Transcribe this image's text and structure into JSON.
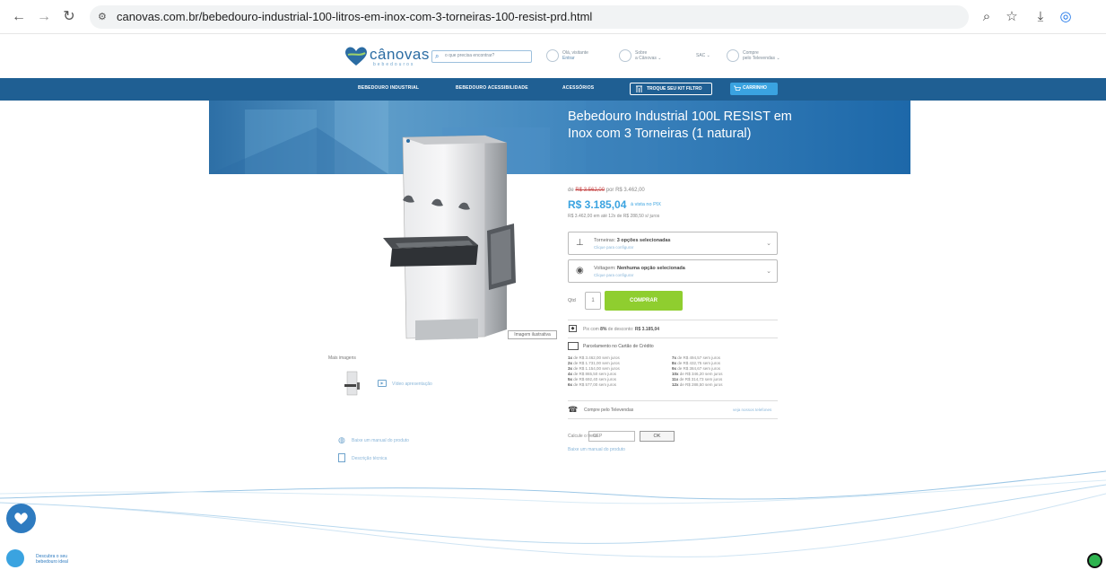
{
  "browser": {
    "url": "canovas.com.br/bebedouro-industrial-100-litros-em-inox-com-3-torneiras-100-resist-prd.html"
  },
  "header": {
    "logo_text": "cânovas",
    "logo_sub": "bebedouros",
    "search_placeholder": "o que precisa encontrar?",
    "login_line1": "Olá, visitante",
    "login_line2": "Entrar",
    "about_line1": "Sobre",
    "about_line2": "a Cânovas",
    "sac_label": "SAC",
    "buy_line1": "Compre",
    "buy_line2": "pelo Televendas"
  },
  "nav": {
    "items": [
      "BEBEDOURO INDUSTRIAL",
      "BEBEDOURO ACESSIBILIDADE",
      "ACESSÓRIOS"
    ],
    "kit_button": "TROQUE SEU KIT FILTRO",
    "cart_button": "CARRINHO"
  },
  "banner": {
    "title": "Bebedouro Industrial 100L RESIST em Inox com 3 Torneiras (1 natural)"
  },
  "product": {
    "image_label": "Imagem ilustrativa",
    "more_images": "Mais imagens",
    "video_link": "Vídeo apresentação",
    "manual_link": "Baixe um manual do produto",
    "description_link": "Descrição técnica"
  },
  "price": {
    "prefix_de": "de",
    "old_price": "R$ 3.562,00",
    "por_text": "por R$ 3.462,00",
    "pix_price": "R$ 3.185,04",
    "pix_note": "à vista no PIX",
    "installments_note": "R$ 3.462,00 em até 12x de R$ 288,50 s/ juros"
  },
  "options": {
    "taps_label": "Torneiras:",
    "taps_value": "3 opções selecionadas",
    "taps_hint": "Clique para configurar",
    "voltage_label": "Voltagem:",
    "voltage_value": "Nenhuma opção selecionada",
    "voltage_hint": "Clique para configurar"
  },
  "purchase": {
    "qty_label": "Qtd",
    "qty_value": "1",
    "buy_button": "COMPRAR"
  },
  "payment": {
    "pix_line_prefix": "Pix com",
    "pix_line_discount": "8%",
    "pix_line_suffix": "de desconto:",
    "pix_line_value": "R$ 3.185,04",
    "card_title": "Parcelamento no Cartão de Crédito",
    "installments_left": [
      {
        "n": "1x",
        "rest": "de R$ 3.462,00 sem juros"
      },
      {
        "n": "2x",
        "rest": "de R$ 1.731,00 sem juros"
      },
      {
        "n": "3x",
        "rest": "de R$ 1.154,00 sem juros"
      },
      {
        "n": "4x",
        "rest": "de R$ 865,50 sem juros"
      },
      {
        "n": "5x",
        "rest": "de R$ 692,40 sem juros"
      },
      {
        "n": "6x",
        "rest": "de R$ 577,00 sem juros"
      }
    ],
    "installments_right": [
      {
        "n": "7x",
        "rest": "de R$ 494,57 sem juros"
      },
      {
        "n": "8x",
        "rest": "de R$ 432,75 sem juros"
      },
      {
        "n": "9x",
        "rest": "de R$ 384,67 sem juros"
      },
      {
        "n": "10x",
        "rest": "de R$ 346,20 sem juros"
      },
      {
        "n": "11x",
        "rest": "de R$ 314,73 sem juros"
      },
      {
        "n": "12x",
        "rest": "de R$ 288,50 sem juros"
      }
    ],
    "phone_text": "Compre pelo Televendas",
    "phone_link": "veja nossos telefones"
  },
  "shipping": {
    "label": "Calcule o frete:",
    "placeholder": "CEP",
    "ok_button": "OK",
    "manual_link": "Baixe um manual do produto"
  },
  "promo": {
    "line1": "Descubra o seu",
    "line2": "bebedouro ideal"
  },
  "colors": {
    "nav_blue": "#1f5f93",
    "accent_blue": "#3aa3e0",
    "buy_green": "#8fce2f"
  }
}
